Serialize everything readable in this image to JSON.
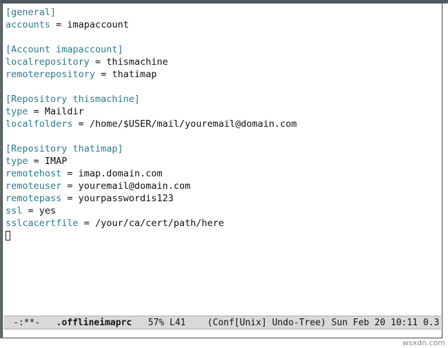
{
  "window": {
    "app": "emacs",
    "frame_border_color": "#3f3f3f",
    "title_bar_color": "#4e5a60",
    "background": "#ffffff"
  },
  "theme": {
    "key_color": "#2a7b8c",
    "section_color": "#2a7b8c",
    "value_color": "#101010",
    "modeline_bg": "#d9d9d9",
    "modeline_fg": "#141414",
    "cursor_color": "#1a1a1a"
  },
  "buffer": {
    "file_name": ".offlineimaprc",
    "lines": [
      {
        "type": "section",
        "text": "[general]",
        "name": "general"
      },
      {
        "type": "pair",
        "key": "accounts",
        "op": " = ",
        "value": "imapaccount"
      },
      {
        "type": "blank",
        "text": ""
      },
      {
        "type": "section",
        "text": "[Account imapaccount]",
        "name": "Account imapaccount"
      },
      {
        "type": "pair",
        "key": "localrepository",
        "op": " = ",
        "value": "thismachine"
      },
      {
        "type": "pair",
        "key": "remoterepository",
        "op": " = ",
        "value": "thatimap"
      },
      {
        "type": "blank",
        "text": ""
      },
      {
        "type": "section",
        "text": "[Repository thismachine]",
        "name": "Repository thismachine"
      },
      {
        "type": "pair",
        "key": "type",
        "op": " = ",
        "value": "Maildir"
      },
      {
        "type": "pair",
        "key": "localfolders",
        "op": " = ",
        "value": "/home/$USER/mail/youremail@domain.com"
      },
      {
        "type": "blank",
        "text": ""
      },
      {
        "type": "section",
        "text": "[Repository thatimap]",
        "name": "Repository thatimap"
      },
      {
        "type": "pair",
        "key": "type",
        "op": " = ",
        "value": "IMAP"
      },
      {
        "type": "pair",
        "key": "remotehost",
        "op": " = ",
        "value": "imap.domain.com"
      },
      {
        "type": "pair",
        "key": "remoteuser",
        "op": " = ",
        "value": "youremail@domain.com"
      },
      {
        "type": "pair",
        "key": "remotepass",
        "op": " = ",
        "value": "yourpasswordis123"
      },
      {
        "type": "pair",
        "key": "ssl",
        "op": " = ",
        "value": "yes"
      },
      {
        "type": "pair",
        "key": "sslcacertfile",
        "op": " = ",
        "value": "/your/ca/cert/path/here"
      },
      {
        "type": "cursor",
        "text": ""
      }
    ]
  },
  "mode_line": {
    "flags": "-:**-",
    "gap1": "   ",
    "buffer_name": ".offlineimaprc",
    "gap2": "   ",
    "percent": "57%",
    "gap3": " ",
    "line_number": "L41",
    "gap4": "    ",
    "major_mode": "(Conf[Unix] Undo-Tree)",
    "gap5": " ",
    "date_time": "Sun Feb 20 10:11",
    "gap6": " ",
    "load_average": "0.3"
  },
  "watermark": {
    "text": "wsxdn.com"
  }
}
